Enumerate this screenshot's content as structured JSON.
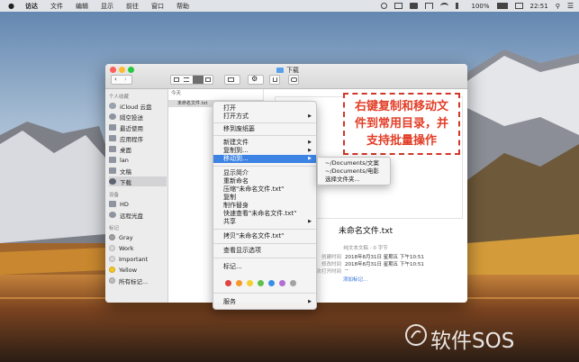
{
  "menubar": {
    "app": "访达",
    "items": [
      "文件",
      "编辑",
      "显示",
      "前往",
      "窗口",
      "帮助"
    ],
    "battery": "100%",
    "clock": "22:51"
  },
  "window": {
    "title": "下载",
    "column_header": "今天",
    "file_row": "未命名文件.txt"
  },
  "sidebar": {
    "favorites_header": "个人收藏",
    "favorites": [
      {
        "label": "iCloud 云盘",
        "icon": "cloud-icon"
      },
      {
        "label": "隔空投送",
        "icon": "airdrop-icon"
      },
      {
        "label": "最近使用",
        "icon": "clock-icon"
      },
      {
        "label": "应用程序",
        "icon": "apps-icon"
      },
      {
        "label": "桌面",
        "icon": "desktop-icon"
      },
      {
        "label": "lan",
        "icon": "home-icon"
      },
      {
        "label": "文稿",
        "icon": "document-icon"
      },
      {
        "label": "下载",
        "icon": "download-icon"
      }
    ],
    "devices_header": "设备",
    "devices": [
      {
        "label": "HD",
        "icon": "disk-icon"
      },
      {
        "label": "远程光盘",
        "icon": "optical-disc-icon"
      }
    ],
    "tags_header": "标记",
    "tags": [
      {
        "label": "Gray",
        "color": "#a0a0a0"
      },
      {
        "label": "Work",
        "color": "#d8d8d8"
      },
      {
        "label": "Important",
        "color": "#d8d8d8"
      },
      {
        "label": "Yellow",
        "color": "#f5c623"
      },
      {
        "label": "所有标记...",
        "color": "#bdbdbd"
      }
    ]
  },
  "preview": {
    "name": "未命名文件.txt",
    "kind": "纯文本文稿 - 0 字节",
    "created_label": "创建时间",
    "created": "2018年8月31日 星期五 下午10:51",
    "modified_label": "修改时间",
    "modified": "2018年8月31日 星期五 下午10:51",
    "opened_label": "上次打开时间",
    "opened": "--",
    "add_tags": "添加标记..."
  },
  "context_menu": {
    "open": "打开",
    "open_with": "打开方式",
    "trash": "移到废纸篓",
    "new_folder": "新建文件",
    "copy_to": "复制到...",
    "move_to": "移动到...",
    "get_info": "显示简介",
    "rename": "重新命名",
    "compress": "压缩\"未命名文件.txt\"",
    "duplicate": "复制",
    "make_alias": "制作替身",
    "quick_look": "快速查看\"未命名文件.txt\"",
    "share": "共享",
    "copy_item": "拷贝\"未命名文件.txt\"",
    "view_options": "查看显示选项",
    "tags": "标记...",
    "tag_colors": [
      "#e0443e",
      "#f39a2b",
      "#f5cf2d",
      "#5ec14b",
      "#3a8ee6",
      "#b36ed6",
      "#a3a3a3"
    ],
    "services": "服务"
  },
  "submenu": {
    "items": [
      "~/Documents/文案",
      "~/Documents/电影",
      "选择文件夹..."
    ]
  },
  "annotation": {
    "line1": "右键复制和移动文",
    "line2": "件到常用目录，并",
    "line3": "支持批量操作"
  },
  "watermark": {
    "text": "软件SOS"
  }
}
